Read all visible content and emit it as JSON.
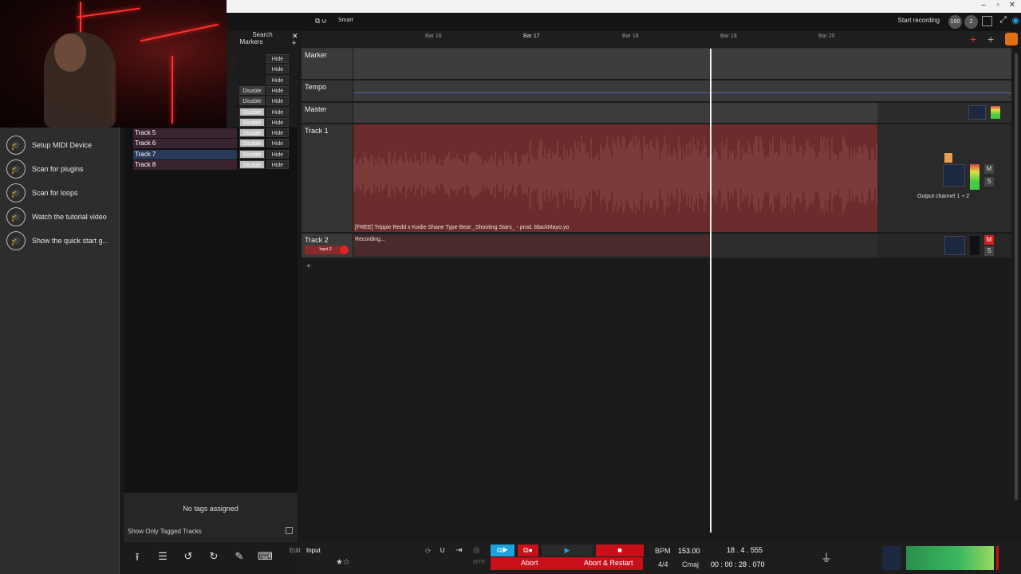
{
  "toolbar": {
    "start_recording": "Start recording",
    "count_badge": "100",
    "two_badge": "2",
    "search_label": "Search",
    "markers_label": "Markers",
    "smart_label": "Smart"
  },
  "sidebar": {
    "items": [
      {
        "label": "Setup MIDI Device",
        "icon": "graduation-cap-icon"
      },
      {
        "label": "Scan for plugins",
        "icon": "graduation-cap-icon"
      },
      {
        "label": "Scan for loops",
        "icon": "graduation-cap-icon"
      },
      {
        "label": "Watch the tutorial video",
        "icon": "graduation-cap-icon"
      },
      {
        "label": "Show the quick start g...",
        "icon": "graduation-cap-icon"
      }
    ]
  },
  "track_list": {
    "rows": [
      {
        "name": "",
        "disable": "",
        "hide": "Hide"
      },
      {
        "name": "",
        "disable": "",
        "hide": "Hide"
      },
      {
        "name": "",
        "disable": "",
        "hide": "Hide"
      },
      {
        "name": "",
        "disable": "Disable",
        "hide": "Hide"
      },
      {
        "name": "",
        "disable": "Disable",
        "hide": "Hide"
      },
      {
        "name": "",
        "disable": "Disable",
        "hide": "Hide"
      },
      {
        "name": "",
        "disable": "Disable",
        "hide": "Hide"
      },
      {
        "name": "Track 5",
        "disable": "Disable",
        "hide": "Hide"
      },
      {
        "name": "Track 6",
        "disable": "Disable",
        "hide": "Hide"
      },
      {
        "name": "Track 7",
        "disable": "Disable",
        "hide": "Hide"
      },
      {
        "name": "Track 8",
        "disable": "Disable",
        "hide": "Hide"
      }
    ],
    "no_tags": "No tags assigned",
    "show_only_tagged": "Show Only Tagged Tracks"
  },
  "ruler": {
    "bars": [
      "Bar 16",
      "Bar 17",
      "Bar 18",
      "Bar 19",
      "Bar 20"
    ]
  },
  "lanes": {
    "marker": "Marker",
    "tempo": "Tempo",
    "master": "Master",
    "track1": "Track 1",
    "track2": "Track 2",
    "input_label": "Input 2"
  },
  "clips": {
    "track1_label": "[FREE] Trippie Redd x Kodie Shane Type Beat _Shooting Stars_ - prod. BlackMayo.yo",
    "track2_label": "Recording..."
  },
  "mixer": {
    "output_channel": "Output channel 1 + 2",
    "mute": "M",
    "solo": "S"
  },
  "transport": {
    "edit": "Edit",
    "input": "Input",
    "abort": "Abort",
    "abort_restart": "Abort & Restart",
    "bpm_label": "BPM",
    "bpm_value": "153.00",
    "position": "18 . 4 . 555",
    "time_sig": "4/4",
    "key": "Cmaj",
    "time": "00 : 00 : 28 . 070",
    "metronome": "MTR"
  },
  "colors": {
    "accent_red": "#c8101a",
    "accent_blue": "#1aa3e0",
    "clip_red": "#6a2c2c"
  }
}
